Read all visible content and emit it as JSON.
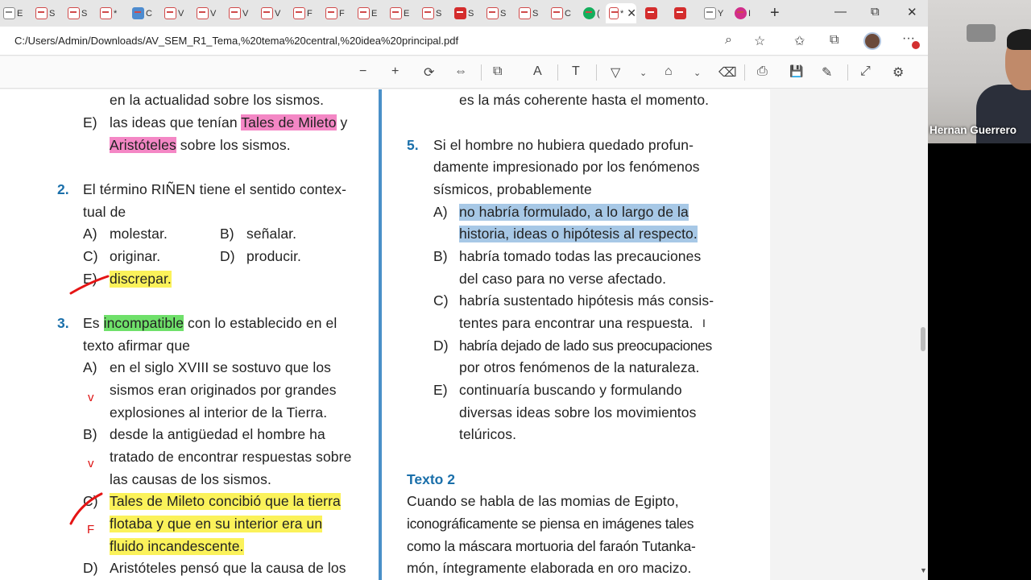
{
  "browser": {
    "tabs": [
      {
        "label": "E",
        "icon": "pdf-icon",
        "style": "doc"
      },
      {
        "label": "S",
        "icon": "pdf-icon",
        "style": ""
      },
      {
        "label": "S",
        "icon": "pdf-icon",
        "style": ""
      },
      {
        "label": "*",
        "icon": "pdf-icon",
        "style": ""
      },
      {
        "label": "C",
        "icon": "image-icon",
        "style": "blue"
      },
      {
        "label": "V",
        "icon": "pdf-icon",
        "style": ""
      },
      {
        "label": "V",
        "icon": "pdf-icon",
        "style": ""
      },
      {
        "label": "V",
        "icon": "pdf-icon",
        "style": ""
      },
      {
        "label": "V",
        "icon": "pdf-icon",
        "style": ""
      },
      {
        "label": "F",
        "icon": "pdf-icon",
        "style": ""
      },
      {
        "label": "F",
        "icon": "pdf-icon",
        "style": ""
      },
      {
        "label": "E",
        "icon": "pdf-icon",
        "style": ""
      },
      {
        "label": "E",
        "icon": "pdf-icon",
        "style": ""
      },
      {
        "label": "S",
        "icon": "pdf-icon",
        "style": ""
      },
      {
        "label": "S",
        "icon": "pdf-icon",
        "style": "red"
      },
      {
        "label": "S",
        "icon": "pdf-icon",
        "style": ""
      },
      {
        "label": "S",
        "icon": "pdf-icon",
        "style": ""
      },
      {
        "label": "C",
        "icon": "pdf-icon",
        "style": ""
      },
      {
        "label": "(",
        "icon": "whatsapp-icon",
        "style": "green"
      },
      {
        "label": "*",
        "icon": "pdf-icon",
        "style": "active"
      },
      {
        "label": "",
        "icon": "pdf-icon",
        "style": "red"
      },
      {
        "label": "",
        "icon": "pdf-icon",
        "style": "red"
      },
      {
        "label": "Y",
        "icon": "doc-icon",
        "style": "doc"
      },
      {
        "label": "I",
        "icon": "instagram-icon",
        "style": "insta"
      }
    ],
    "new_tab": "+",
    "minimize": "—",
    "restore": "⧉",
    "close": "✕",
    "url": "C:/Users/Admin/Downloads/AV_SEM_R1_Tema,%20tema%20central,%20idea%20principal.pdf"
  },
  "pdf_toolbar": {
    "zoom_out": "−",
    "zoom_in": "+",
    "rotate": "⟳",
    "fit": "⇔",
    "page_view": "⧉",
    "read_aloud": "A",
    "text": "T",
    "draw": "▽",
    "highlight": "⌂",
    "erase": "⌫",
    "print": "⎙",
    "save": "💾",
    "save_as": "✎",
    "fullscreen": "⤢",
    "settings": "⚙"
  },
  "left_col": {
    "l1": "en la actualidad sobre los sismos.",
    "e_letter": "E)",
    "e_pre": "las ideas que tenían ",
    "e_hl1": "Tales de Mileto",
    "e_mid": " y",
    "e_hl2": "Aristóteles",
    "e_post": " sobre los sismos.",
    "q2_num": "2.",
    "q2_l1": "El término RIÑEN tiene el sentido contex-",
    "q2_l2": "tual de",
    "q2_a": "A)",
    "q2_a_text": "molestar.",
    "q2_b": "B)",
    "q2_b_text": "señalar.",
    "q2_c": "C)",
    "q2_c_text": "originar.",
    "q2_d": "D)",
    "q2_d_text": "producir.",
    "q2_e": "E)",
    "q2_e_text": "discrepar.",
    "q3_num": "3.",
    "q3_pre": "Es ",
    "q3_hl": "incompatible",
    "q3_post": " con lo establecido en el",
    "q3_l2": "texto afirmar que",
    "q3_a": "A)",
    "q3_a1": "en el siglo XVIII se sostuvo que los",
    "q3_a2": "sismos eran originados por grandes",
    "q3_a3": "explosiones al interior de la Tierra.",
    "q3_b": "B)",
    "q3_b1": "desde la antigüedad el hombre ha",
    "q3_b2": "tratado de encontrar respuestas sobre",
    "q3_b3": "las causas de los sismos.",
    "q3_c": "C)",
    "q3_c1": "Tales de Mileto concibió que la tierra",
    "q3_c2": "flotaba y que en su interior era un",
    "q3_c3": "fluido incandescente.",
    "q3_d": "D)",
    "q3_d1": "Aristóteles pensó que la causa de los",
    "mark_v1": "v",
    "mark_v2": "v",
    "mark_f": "F"
  },
  "right_col": {
    "r0": "es la más coherente hasta el momento.",
    "q5_num": "5.",
    "q5_l1": "Si el hombre no hubiera quedado profun-",
    "q5_l2": "damente impresionado por los fenómenos",
    "q5_l3": "sísmicos, probablemente",
    "q5_a": "A)",
    "q5_a1": "no habría formulado, a lo largo de la",
    "q5_a2": "historia, ideas o hipótesis al respecto.",
    "q5_b": "B)",
    "q5_b1": "habría tomado todas las precauciones",
    "q5_b2": "del caso para no verse afectado.",
    "q5_c": "C)",
    "q5_c1": "habría sustentado hipótesis más consis-",
    "q5_c2": "tentes para encontrar una respuesta.",
    "q5_d": "D)",
    "q5_d1": "habría dejado de lado sus preocupaciones",
    "q5_d2": "por otros fenómenos de la naturaleza.",
    "q5_e": "E)",
    "q5_e1": "continuaría buscando y formulando",
    "q5_e2": "diversas ideas sobre los movimientos",
    "q5_e3": "telúricos.",
    "texto2": "Texto 2",
    "t2_l1": "Cuando se habla de las momias de Egipto,",
    "t2_l2": "iconográficamente se piensa en imágenes tales",
    "t2_l3": "como la máscara mortuoria del faraón Tutanka-",
    "t2_l4": "món, íntegramente elaborada en oro macizo."
  },
  "webcam": {
    "name": "Hernan Guerrero"
  },
  "colors": {
    "accent_blue": "#1a6faa",
    "highlight_pink": "#f487c5",
    "highlight_green": "#6fe06a",
    "highlight_yellow": "#fbf25a",
    "highlight_blue": "#a7c8e6",
    "ink_red": "#dd1111"
  }
}
